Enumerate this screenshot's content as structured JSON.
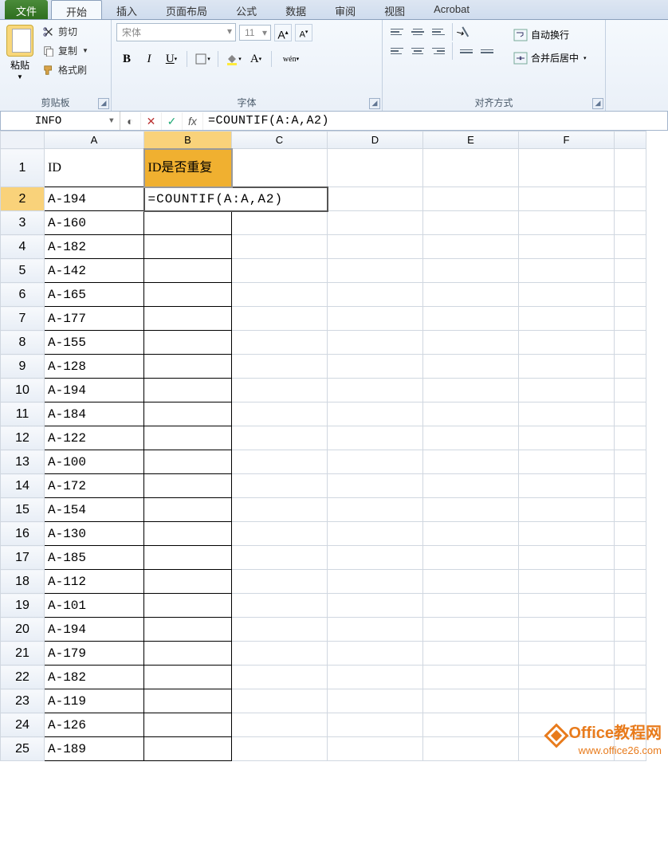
{
  "tabs": {
    "file": "文件",
    "home": "开始",
    "insert": "插入",
    "layout": "页面布局",
    "formula": "公式",
    "data": "数据",
    "review": "审阅",
    "view": "视图",
    "acrobat": "Acrobat"
  },
  "clipboard": {
    "paste": "粘贴",
    "cut": "剪切",
    "copy": "复制",
    "format_painter": "格式刷",
    "group_label": "剪贴板"
  },
  "font": {
    "name": "宋体",
    "size": "11",
    "group_label": "字体",
    "pinyin": "wén"
  },
  "alignment": {
    "wrap": "自动换行",
    "merge": "合并后居中",
    "group_label": "对齐方式"
  },
  "namebox": "INFO",
  "formula_value": "=COUNTIF(A:A,A2)",
  "columns": [
    "A",
    "B",
    "C",
    "D",
    "E",
    "F"
  ],
  "header_row": {
    "a": "ID",
    "b": "ID是否重复"
  },
  "editing_cell": "=COUNTIF(A:A,A2)",
  "ids": [
    "A-194",
    "A-160",
    "A-182",
    "A-142",
    "A-165",
    "A-177",
    "A-155",
    "A-128",
    "A-194",
    "A-184",
    "A-122",
    "A-100",
    "A-172",
    "A-154",
    "A-130",
    "A-185",
    "A-112",
    "A-101",
    "A-194",
    "A-179",
    "A-182",
    "A-119",
    "A-126",
    "A-189"
  ],
  "watermark": {
    "line1": "Office教程网",
    "line2": "www.office26.com"
  }
}
